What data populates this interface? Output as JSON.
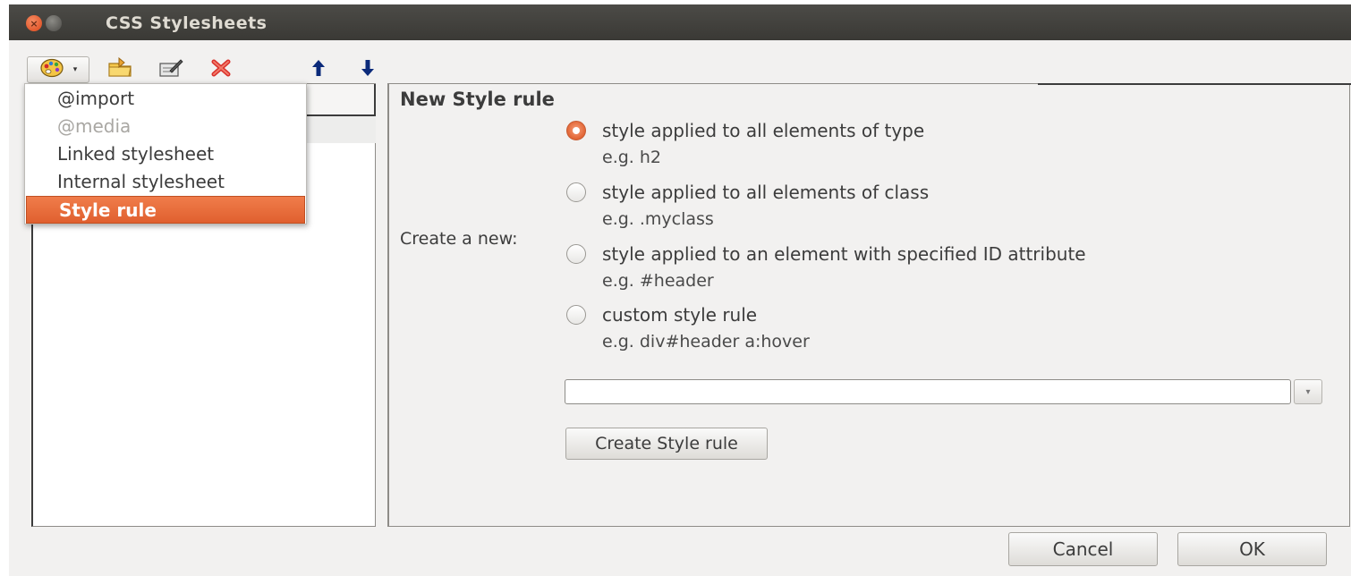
{
  "window": {
    "title": "CSS Stylesheets",
    "close_glyph": "×",
    "maximize_glyph": "□"
  },
  "toolbar": {
    "icons": [
      "new-style-palette-icon",
      "import-icon",
      "edit-icon",
      "delete-icon",
      "move-up-icon",
      "move-down-icon"
    ],
    "dropdown_glyph": "▾"
  },
  "new_menu": {
    "items": [
      {
        "label": "@import",
        "state": "enabled"
      },
      {
        "label": "@media",
        "state": "disabled"
      },
      {
        "label": "Linked stylesheet",
        "state": "enabled"
      },
      {
        "label": "Internal stylesheet",
        "state": "enabled"
      },
      {
        "label": "Style rule",
        "state": "selected"
      }
    ]
  },
  "panel": {
    "title": "New Style rule",
    "create_label": "Create a new:",
    "options": [
      {
        "label": "style applied to all elements of type",
        "example": "e.g. h2",
        "checked": true
      },
      {
        "label": "style applied to all elements of class",
        "example": "e.g. .myclass",
        "checked": false
      },
      {
        "label": "style applied to an element with specified ID attribute",
        "example": "e.g. #header",
        "checked": false
      },
      {
        "label": "custom style rule",
        "example": "e.g. div#header a:hover",
        "checked": false
      }
    ],
    "selector_value": "",
    "selector_placeholder": "",
    "dropdown_glyph": "▾",
    "create_button": "Create Style rule"
  },
  "footer": {
    "cancel": "Cancel",
    "ok": "OK"
  },
  "colors": {
    "accent": "#e0602f",
    "titlebar": "#3c3b37",
    "window_bg": "#f2f1f0"
  }
}
